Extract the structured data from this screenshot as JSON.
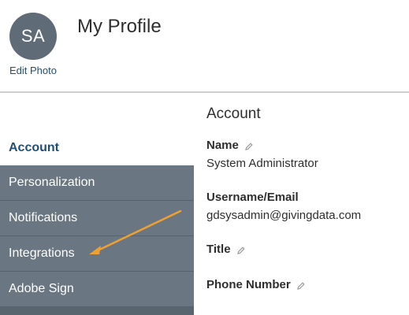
{
  "header": {
    "avatar_initials": "SA",
    "edit_photo_label": "Edit Photo",
    "title": "My Profile"
  },
  "nav": {
    "items": [
      {
        "label": "Account",
        "active": true
      },
      {
        "label": "Personalization",
        "active": false
      },
      {
        "label": "Notifications",
        "active": false
      },
      {
        "label": "Integrations",
        "active": false
      },
      {
        "label": "Adobe Sign",
        "active": false
      }
    ]
  },
  "account": {
    "section_title": "Account",
    "name_label": "Name",
    "name_value": "System Administrator",
    "username_label": "Username/Email",
    "username_value": "gdsysadmin@givingdata.com",
    "title_label": "Title",
    "phone_label": "Phone Number"
  },
  "colors": {
    "accent": "#1f4e79",
    "nav_bg": "#6a7782",
    "annotation_arrow": "#f0a030"
  },
  "icons": {
    "edit": "pencil-icon"
  }
}
